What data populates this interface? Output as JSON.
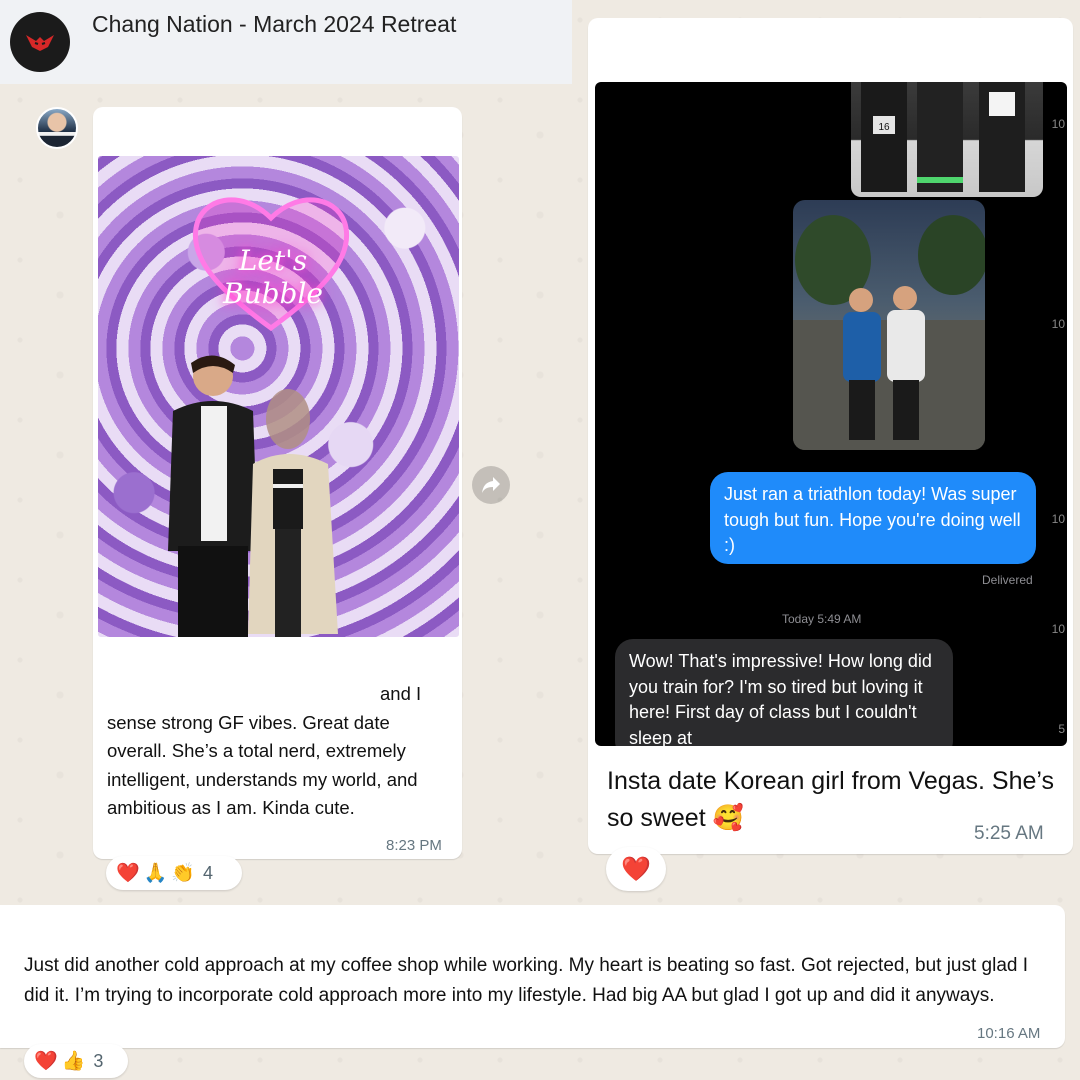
{
  "header": {
    "title": "Chang Nation - March 2024 Retreat",
    "avatar_icon": "group-logo-icon"
  },
  "messages": [
    {
      "id": "left",
      "neon_sign_text": "Let's Bubble",
      "text_first_line": "and I",
      "text_rest": "sense strong GF vibes. Great date overall. She’s a total nerd, extremely intelligent, understands my world, and ambitious as I am. Kinda cute.",
      "time": "8:23 PM",
      "reactions": {
        "emojis": [
          "❤️",
          "🙏",
          "👏"
        ],
        "count": "4"
      }
    },
    {
      "id": "right",
      "screenshot": {
        "sent_text": "Just ran a triathlon today! Was super tough but fun. Hope you're doing well :)",
        "status": "Delivered",
        "timestamp": "Today 5:49 AM",
        "received_text": "Wow! That's impressive! How long did you train for? I'm so tired but loving it here! First day of class but I couldn't sleep at",
        "bib_number": "16",
        "side_ticks": [
          "10",
          "10",
          "10",
          "10",
          "5"
        ]
      },
      "caption": "Insta date Korean girl from Vegas. She’s so sweet 🥰",
      "time": "5:25 AM",
      "reactions": {
        "emojis": [
          "❤️"
        ]
      }
    },
    {
      "id": "bottom",
      "text": "Just did another cold approach at my coffee shop while working. My heart is beating so fast. Got rejected, but just glad I did it. I’m trying to incorporate cold approach more into my lifestyle. Had big AA but glad I got up and did it anyways.",
      "time": "10:16 AM",
      "reactions": {
        "emojis": [
          "❤️",
          "👍"
        ],
        "count": "3"
      }
    }
  ],
  "colors": {
    "chat_background": "#efeae2",
    "header_background": "#f0f2f5",
    "imessage_blue": "#1f8bfa",
    "imessage_gray": "#2b2b2d"
  }
}
